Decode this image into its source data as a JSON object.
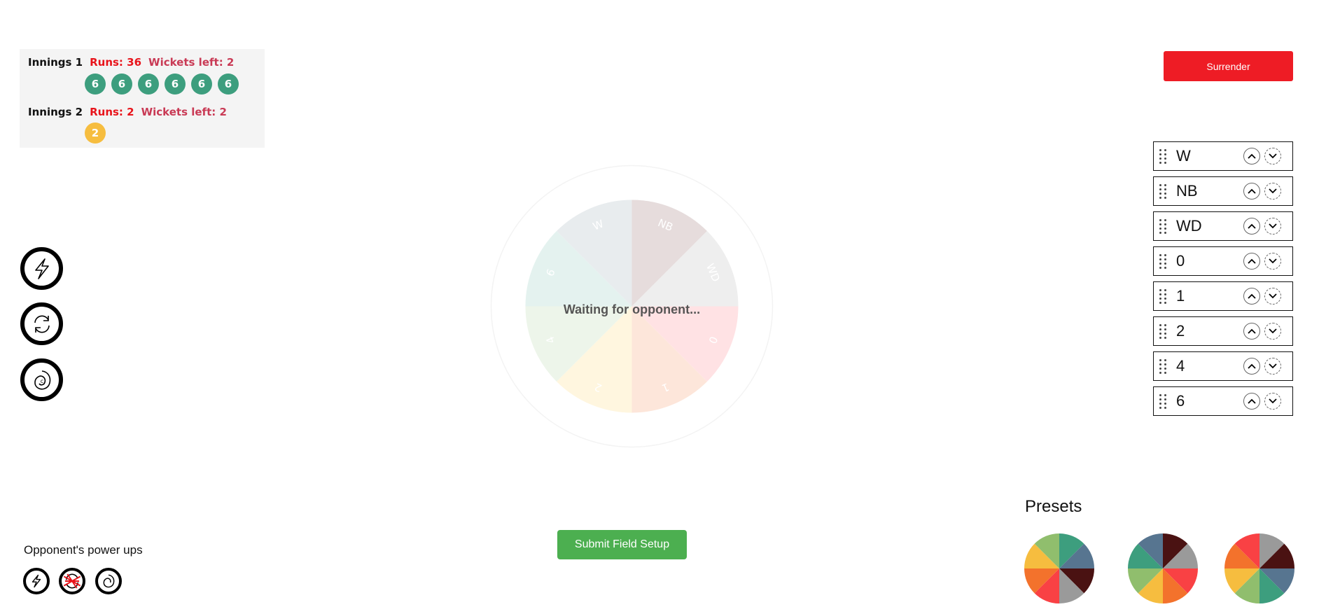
{
  "scoreboard": {
    "innings": [
      {
        "label": "Innings 1",
        "runs": "Runs: 36",
        "wickets": "Wickets left: 2",
        "balls": [
          "6",
          "6",
          "6",
          "6",
          "6",
          "6"
        ],
        "ball_color": "#3d9e7e"
      },
      {
        "label": "Innings 2",
        "runs": "Runs: 2",
        "wickets": "Wickets left: 2",
        "balls": [
          "2"
        ],
        "ball_color": "#f6bd3f"
      }
    ]
  },
  "surrender": {
    "label": "Surrender"
  },
  "powerups": [
    {
      "icon": "lightning-icon"
    },
    {
      "icon": "refresh-icon"
    },
    {
      "icon": "spiral-coin-icon"
    }
  ],
  "wheel": {
    "status": "Waiting for opponent...",
    "segments": [
      {
        "label": "NB",
        "color": "#e6dcdc"
      },
      {
        "label": "WD",
        "color": "#eeeeee"
      },
      {
        "label": "0",
        "color": "#ffe2e4"
      },
      {
        "label": "1",
        "color": "#fde6da"
      },
      {
        "label": "2",
        "color": "#fff6df"
      },
      {
        "label": "4",
        "color": "#edf5ea"
      },
      {
        "label": "6",
        "color": "#e4f2ef"
      },
      {
        "label": "W",
        "color": "#e8ecee"
      }
    ]
  },
  "order_list": [
    "W",
    "NB",
    "WD",
    "0",
    "1",
    "2",
    "4",
    "6"
  ],
  "presets": {
    "title": "Presets",
    "items": [
      {
        "colors": [
          "#3d9e7e",
          "#577590",
          "#4a1212",
          "#9a9a9a",
          "#f94144",
          "#f3722c",
          "#f6bd3f",
          "#90be6d"
        ]
      },
      {
        "colors": [
          "#4a1212",
          "#9a9a9a",
          "#f94144",
          "#f3722c",
          "#f6bd3f",
          "#90be6d",
          "#3d9e7e",
          "#577590"
        ]
      },
      {
        "colors": [
          "#9a9a9a",
          "#4a1212",
          "#577590",
          "#3d9e7e",
          "#90be6d",
          "#f6bd3f",
          "#f3722c",
          "#f94144"
        ]
      }
    ]
  },
  "submit": {
    "label": "Submit Field Setup"
  },
  "opponent": {
    "title": "Opponent's power ups",
    "powerups": [
      {
        "icon": "lightning-icon",
        "used": false
      },
      {
        "icon": "refresh-icon",
        "used": true
      },
      {
        "icon": "spiral-coin-icon",
        "used": false
      }
    ]
  },
  "colors": {
    "surrender": "#ee1c25",
    "submit": "#4caf50",
    "runs": "#e8141b",
    "wickets": "#c93a55"
  }
}
